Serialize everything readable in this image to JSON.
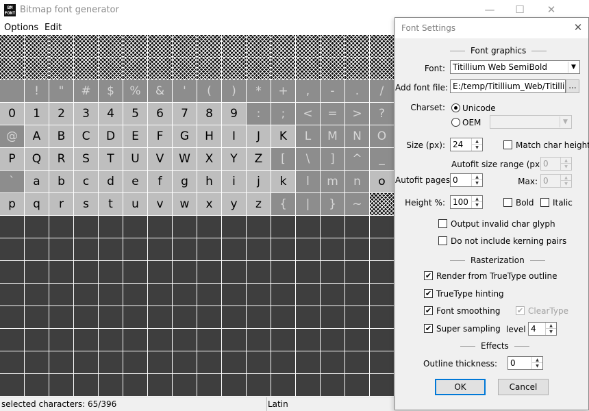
{
  "window": {
    "title": "Bitmap font generator",
    "icon_text": "BM FONT"
  },
  "menu": {
    "items": [
      "Options",
      "Edit"
    ]
  },
  "grid": {
    "rows": [
      [
        "",
        "",
        "",
        "",
        "",
        "",
        "",
        "",
        "",
        "",
        "",
        "",
        "",
        "",
        "",
        ""
      ],
      [
        "",
        "",
        "",
        "",
        "",
        "",
        "",
        "",
        "",
        "",
        "",
        "",
        "",
        "",
        "",
        ""
      ],
      [
        " ",
        "!",
        "\"",
        "#",
        "$",
        "%",
        "&",
        "'",
        "(",
        ")",
        "*",
        "+",
        ",",
        "-",
        ".",
        "/"
      ],
      [
        "0",
        "1",
        "2",
        "3",
        "4",
        "5",
        "6",
        "7",
        "8",
        "9",
        ":",
        ";",
        "<",
        "=",
        ">",
        "?"
      ],
      [
        "@",
        "A",
        "B",
        "C",
        "D",
        "E",
        "F",
        "G",
        "H",
        "I",
        "J",
        "K",
        "L",
        "M",
        "N",
        "O"
      ],
      [
        "P",
        "Q",
        "R",
        "S",
        "T",
        "U",
        "V",
        "W",
        "X",
        "Y",
        "Z",
        "[",
        "\\",
        "]",
        "^",
        "_"
      ],
      [
        "`",
        "a",
        "b",
        "c",
        "d",
        "e",
        "f",
        "g",
        "h",
        "i",
        "j",
        "k",
        "l",
        "m",
        "n",
        "o"
      ],
      [
        "p",
        "q",
        "r",
        "s",
        "t",
        "u",
        "v",
        "w",
        "x",
        "y",
        "z",
        "{",
        "|",
        "}",
        "~",
        ""
      ]
    ],
    "states": [
      "xxxxxxxxxxxxxxxx",
      "xxxxxxxxxxxxxxxx",
      "1111111111111111",
      "2222222222111111",
      "1222222222221111",
      "2222222222211111",
      "1222222222221112",
      "222222222221111x"
    ],
    "empty_rows": 8
  },
  "status": {
    "selected": "selected characters: 65/396",
    "charset": "Latin"
  },
  "dialog": {
    "title": "Font Settings",
    "font_graphics_header": "Font graphics",
    "font_label": "Font:",
    "font_value": "Titillium Web SemiBold",
    "add_font_label": "Add font file:",
    "add_font_value": "E:/temp/Titillium_Web/TitilliumWeb",
    "browse_label": "...",
    "charset_label": "Charset:",
    "unicode_label": "Unicode",
    "oem_label": "OEM",
    "oem_value": "",
    "size_label": "Size (px):",
    "size_value": "24",
    "match_char_height_label": "Match char height",
    "autofit_range_label": "Autofit size range (px) Min:",
    "autofit_min_value": "0",
    "autofit_pages_label": "Autofit pages:",
    "autofit_pages_value": "0",
    "max_label": "Max:",
    "autofit_max_value": "0",
    "height_label": "Height %:",
    "height_value": "100",
    "bold_label": "Bold",
    "italic_label": "Italic",
    "output_invalid_label": "Output invalid char glyph",
    "no_kerning_label": "Do not include kerning pairs",
    "rasterization_header": "Rasterization",
    "render_truetype_label": "Render from TrueType outline",
    "truetype_hinting_label": "TrueType hinting",
    "font_smoothing_label": "Font smoothing",
    "cleartype_label": "ClearType",
    "super_sampling_label": "Super sampling",
    "level_label": "level",
    "level_value": "4",
    "effects_header": "Effects",
    "outline_label": "Outline thickness:",
    "outline_value": "0",
    "ok_label": "OK",
    "cancel_label": "Cancel",
    "checks": {
      "match_char_height": false,
      "bold": false,
      "italic": false,
      "output_invalid": false,
      "no_kerning": false,
      "render_truetype": true,
      "truetype_hinting": true,
      "font_smoothing": true,
      "cleartype": true,
      "super_sampling": true
    },
    "charset_selected": "unicode"
  }
}
